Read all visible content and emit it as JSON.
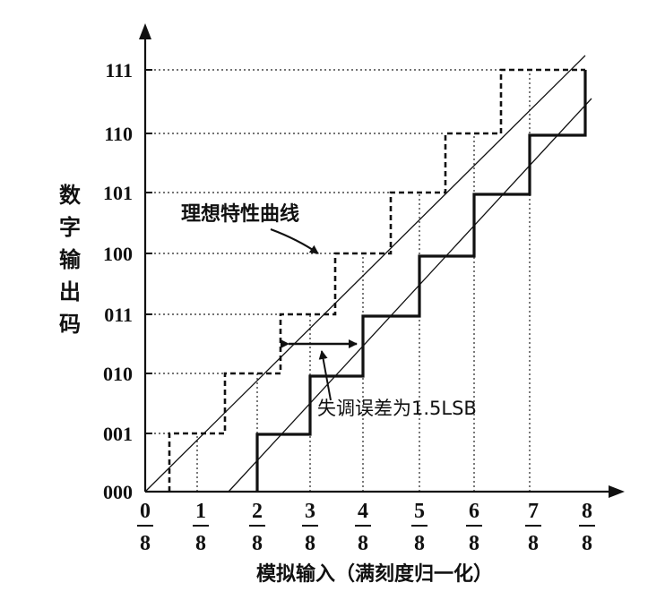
{
  "diagram": {
    "y_axis_title_chars": [
      "数",
      "字",
      "输",
      "出",
      "码"
    ],
    "x_axis_title": "模拟输入（满刻度归一化）",
    "y_tick_labels": [
      "000",
      "001",
      "010",
      "011",
      "100",
      "101",
      "110",
      "111"
    ],
    "x_tick_numerators": [
      "0",
      "1",
      "2",
      "3",
      "4",
      "5",
      "6",
      "7",
      "8"
    ],
    "x_tick_denominator": "8",
    "ideal_curve_label": "理想特性曲线",
    "offset_error_label": "失调误差为1.5LSB",
    "offset_error_lsb": 1.5,
    "ideal_staircase": [
      [
        0.5,
        1
      ],
      [
        1.5,
        2
      ],
      [
        2.5,
        3
      ],
      [
        3.5,
        4
      ],
      [
        4.5,
        5
      ],
      [
        5.5,
        6
      ],
      [
        6.5,
        7
      ]
    ],
    "offset_staircase": [
      [
        2,
        1
      ],
      [
        3,
        2
      ],
      [
        4,
        3
      ],
      [
        5,
        4
      ],
      [
        6,
        5
      ],
      [
        7,
        6
      ],
      [
        8,
        7
      ]
    ]
  }
}
